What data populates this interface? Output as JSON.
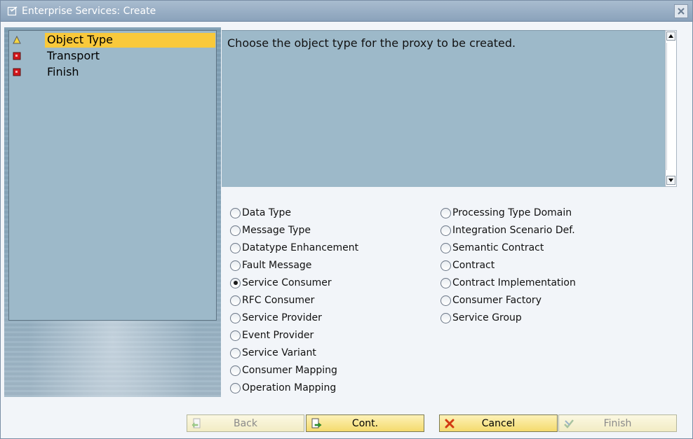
{
  "window": {
    "title": "Enterprise Services: Create"
  },
  "steps": [
    {
      "label": "Object Type",
      "status": "warning",
      "active": true
    },
    {
      "label": "Transport",
      "status": "error",
      "active": false
    },
    {
      "label": "Finish",
      "status": "error",
      "active": false
    }
  ],
  "info": {
    "text": "Choose the object type for the proxy to be created."
  },
  "options_left": [
    {
      "label": "Data Type",
      "selected": false
    },
    {
      "label": "Message Type",
      "selected": false
    },
    {
      "label": "Datatype Enhancement",
      "selected": false
    },
    {
      "label": "Fault Message",
      "selected": false
    },
    {
      "label": "Service Consumer",
      "selected": true
    },
    {
      "label": "RFC Consumer",
      "selected": false
    },
    {
      "label": "Service Provider",
      "selected": false
    },
    {
      "label": "Event Provider",
      "selected": false
    },
    {
      "label": "Service Variant",
      "selected": false
    },
    {
      "label": "Consumer Mapping",
      "selected": false
    },
    {
      "label": "Operation Mapping",
      "selected": false
    }
  ],
  "options_right": [
    {
      "label": "Processing Type Domain",
      "selected": false
    },
    {
      "label": "Integration Scenario Def.",
      "selected": false
    },
    {
      "label": "Semantic Contract",
      "selected": false
    },
    {
      "label": "Contract",
      "selected": false
    },
    {
      "label": "Contract Implementation",
      "selected": false
    },
    {
      "label": "Consumer Factory",
      "selected": false
    },
    {
      "label": "Service Group",
      "selected": false
    }
  ],
  "buttons": {
    "back": {
      "label": "Back",
      "enabled": false
    },
    "cont": {
      "label": "Cont.",
      "enabled": true
    },
    "cancel": {
      "label": "Cancel",
      "enabled": true
    },
    "finish": {
      "label": "Finish",
      "enabled": false
    }
  },
  "colors": {
    "active_step": "#f9c93b",
    "panel": "#9db9c9",
    "button_enabled": "#f4da6d"
  }
}
